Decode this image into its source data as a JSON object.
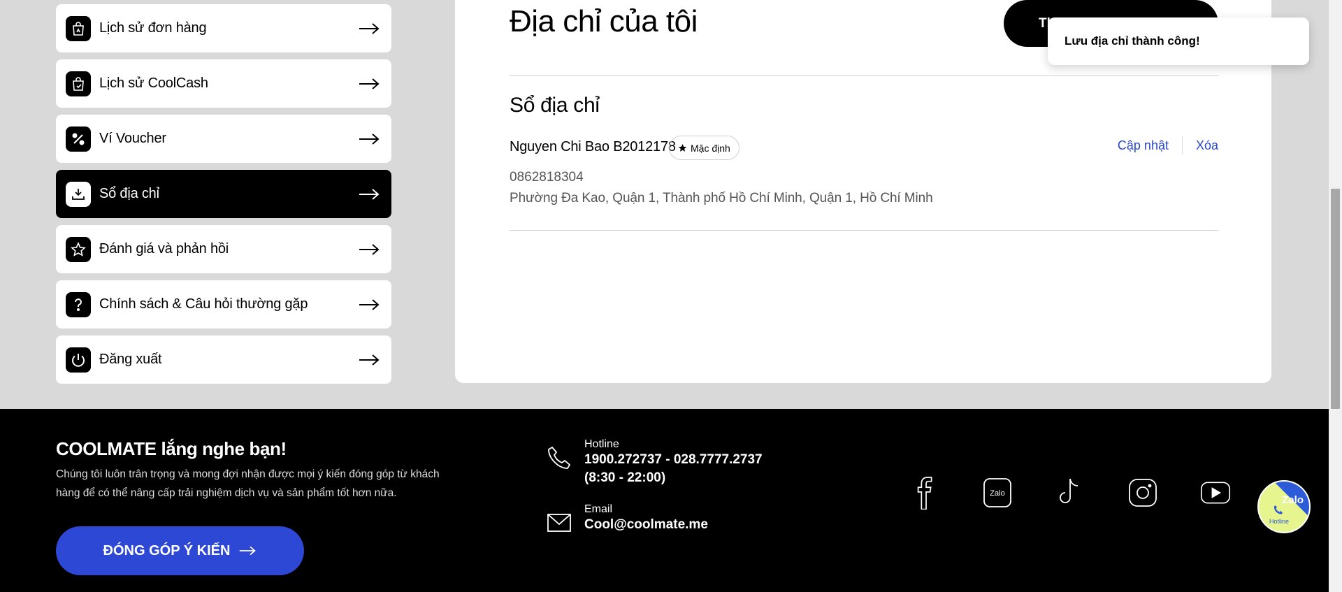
{
  "sidebar": {
    "items": [
      {
        "label": "Lịch sử đơn hàng",
        "icon": "order-bag-icon"
      },
      {
        "label": "Lịch sử CoolCash",
        "icon": "coolcash-bag-icon"
      },
      {
        "label": "Ví Voucher",
        "icon": "percent-icon"
      },
      {
        "label": "Sổ địa chỉ",
        "icon": "address-download-icon",
        "active": true
      },
      {
        "label": "Đánh giá và phản hồi",
        "icon": "star-icon"
      },
      {
        "label": "Chính sách & Câu hỏi thường gặp",
        "icon": "question-icon"
      },
      {
        "label": "Đăng xuất",
        "icon": "power-icon"
      }
    ]
  },
  "main": {
    "title": "Địa chỉ của tôi",
    "add_button_label": "Th",
    "section_title": "Sổ địa chỉ",
    "address": {
      "name": "Nguyen Chi Bao B2012178",
      "default_badge": "Mặc định",
      "update_label": "Cập nhật",
      "delete_label": "Xóa",
      "phone": "0862818304",
      "full_address": "Phường Đa Kao, Quận 1, Thành phố Hồ Chí Minh, Quận 1, Hồ Chí Minh"
    }
  },
  "toast": {
    "message": "Lưu địa chỉ thành công!"
  },
  "footer": {
    "title": "COOLMATE lắng nghe bạn!",
    "description": "Chúng tôi luôn trân trọng và mong đợi nhận được mọi ý kiến đóng góp từ khách hàng để có thể nâng cấp trải nghiệm dịch vụ và sản phẩm tốt hơn nữa.",
    "feedback_button": "ĐÓNG GÓP Ý KIẾN",
    "hotline_label": "Hotline",
    "hotline_numbers": "1900.272737 - 028.7777.2737",
    "hotline_hours": "(8:30 - 22:00)",
    "email_label": "Email",
    "email_value": "Cool@coolmate.me",
    "socials": [
      "facebook-icon",
      "zalo-icon",
      "tiktok-icon",
      "instagram-icon",
      "youtube-icon"
    ],
    "zalo_social_text": "Zalo"
  },
  "floating_widget": {
    "zalo": "Zalo",
    "hotline": "Hotline"
  },
  "colors": {
    "accent_blue": "#2d48d5",
    "link_blue": "#2a48c2",
    "background": "#d9d9d9"
  }
}
